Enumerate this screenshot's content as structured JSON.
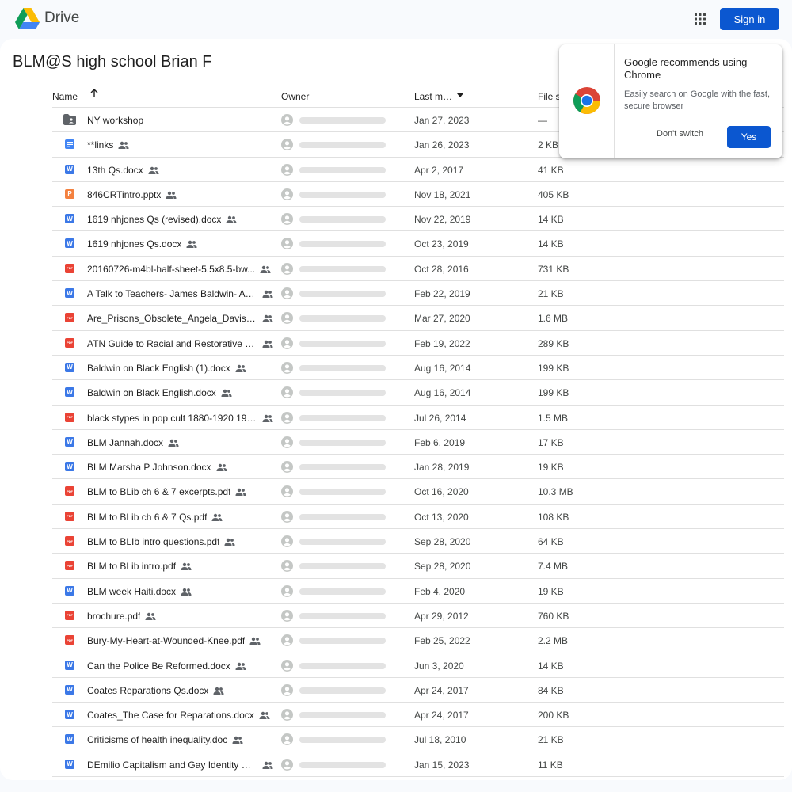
{
  "app": {
    "name": "Drive",
    "sign_in_label": "Sign in"
  },
  "folder": {
    "title": "BLM@S high school Brian F"
  },
  "columns": {
    "name": "Name",
    "owner": "Owner",
    "last_modified": "Last m…",
    "file_size": "File s"
  },
  "popup": {
    "title": "Google recommends using Chrome",
    "body": "Easily search on Google with the fast, secure browser",
    "dont_switch_label": "Don't switch",
    "yes_label": "Yes"
  },
  "colors": {
    "accent": "#0b57d0",
    "word": "#3b78e7",
    "doc": "#4285f4",
    "pdf": "#ea4335",
    "ppt": "#f4813f"
  },
  "files": [
    {
      "name": "NY workshop",
      "type": "folder",
      "shared": false,
      "modified": "Jan 27, 2023",
      "size": "—"
    },
    {
      "name": "**links",
      "type": "doc",
      "shared": true,
      "modified": "Jan 26, 2023",
      "size": "2 KB"
    },
    {
      "name": "13th Qs.docx",
      "type": "word",
      "shared": true,
      "modified": "Apr 2, 2017",
      "size": "41 KB"
    },
    {
      "name": "846CRTintro.pptx",
      "type": "ppt",
      "shared": true,
      "modified": "Nov 18, 2021",
      "size": "405 KB"
    },
    {
      "name": "1619 nhjones Qs (revised).docx",
      "type": "word",
      "shared": true,
      "modified": "Nov 22, 2019",
      "size": "14 KB"
    },
    {
      "name": "1619 nhjones Qs.docx",
      "type": "word",
      "shared": true,
      "modified": "Oct 23, 2019",
      "size": "14 KB"
    },
    {
      "name": "20160726-m4bl-half-sheet-5.5x8.5-bw...",
      "type": "pdf",
      "shared": true,
      "modified": "Oct 28, 2016",
      "size": "731 KB"
    },
    {
      "name": "A Talk to Teachers- James Baldwin- Ad...",
      "type": "word",
      "shared": true,
      "modified": "Feb 22, 2019",
      "size": "21 KB"
    },
    {
      "name": "Are_Prisons_Obsolete_Angela_Davis.pdf",
      "type": "pdf",
      "shared": true,
      "modified": "Mar 27, 2020",
      "size": "1.6 MB"
    },
    {
      "name": "ATN Guide to Racial and Restorative Jus...",
      "type": "pdf",
      "shared": true,
      "modified": "Feb 19, 2022",
      "size": "289 KB"
    },
    {
      "name": "Baldwin on Black English (1).docx",
      "type": "word",
      "shared": true,
      "modified": "Aug 16, 2014",
      "size": "199 KB"
    },
    {
      "name": "Baldwin on Black English.docx",
      "type": "word",
      "shared": true,
      "modified": "Aug 16, 2014",
      "size": "199 KB"
    },
    {
      "name": "black stypes in pop cult 1880-1920 197...",
      "type": "pdf",
      "shared": true,
      "modified": "Jul 26, 2014",
      "size": "1.5 MB"
    },
    {
      "name": "BLM Jannah.docx",
      "type": "word",
      "shared": true,
      "modified": "Feb 6, 2019",
      "size": "17 KB"
    },
    {
      "name": "BLM Marsha P Johnson.docx",
      "type": "word",
      "shared": true,
      "modified": "Jan 28, 2019",
      "size": "19 KB"
    },
    {
      "name": "BLM to BLib ch 6 & 7 excerpts.pdf",
      "type": "pdf",
      "shared": true,
      "modified": "Oct 16, 2020",
      "size": "10.3 MB"
    },
    {
      "name": "BLM to BLib ch 6 & 7 Qs.pdf",
      "type": "pdf",
      "shared": true,
      "modified": "Oct 13, 2020",
      "size": "108 KB"
    },
    {
      "name": "BLM to BLIb intro questions.pdf",
      "type": "pdf",
      "shared": true,
      "modified": "Sep 28, 2020",
      "size": "64 KB"
    },
    {
      "name": "BLM to BLib intro.pdf",
      "type": "pdf",
      "shared": true,
      "modified": "Sep 28, 2020",
      "size": "7.4 MB"
    },
    {
      "name": "BLM week Haiti.docx",
      "type": "word",
      "shared": true,
      "modified": "Feb 4, 2020",
      "size": "19 KB"
    },
    {
      "name": "brochure.pdf",
      "type": "pdf",
      "shared": true,
      "modified": "Apr 29, 2012",
      "size": "760 KB"
    },
    {
      "name": "Bury-My-Heart-at-Wounded-Knee.pdf",
      "type": "pdf",
      "shared": true,
      "modified": "Feb 25, 2022",
      "size": "2.2 MB"
    },
    {
      "name": "Can the Police Be Reformed.docx",
      "type": "word",
      "shared": true,
      "modified": "Jun 3, 2020",
      "size": "14 KB"
    },
    {
      "name": "Coates Reparations Qs.docx",
      "type": "word",
      "shared": true,
      "modified": "Apr 24, 2017",
      "size": "84 KB"
    },
    {
      "name": "Coates_The Case for Reparations.docx",
      "type": "word",
      "shared": true,
      "modified": "Apr 24, 2017",
      "size": "200 KB"
    },
    {
      "name": "Criticisms of health inequality.doc",
      "type": "word",
      "shared": true,
      "modified": "Jul 18, 2010",
      "size": "21 KB"
    },
    {
      "name": "DEmilio Capitalism and Gay Identity Qs....",
      "type": "word",
      "shared": true,
      "modified": "Jan 15, 2023",
      "size": "11 KB"
    }
  ]
}
